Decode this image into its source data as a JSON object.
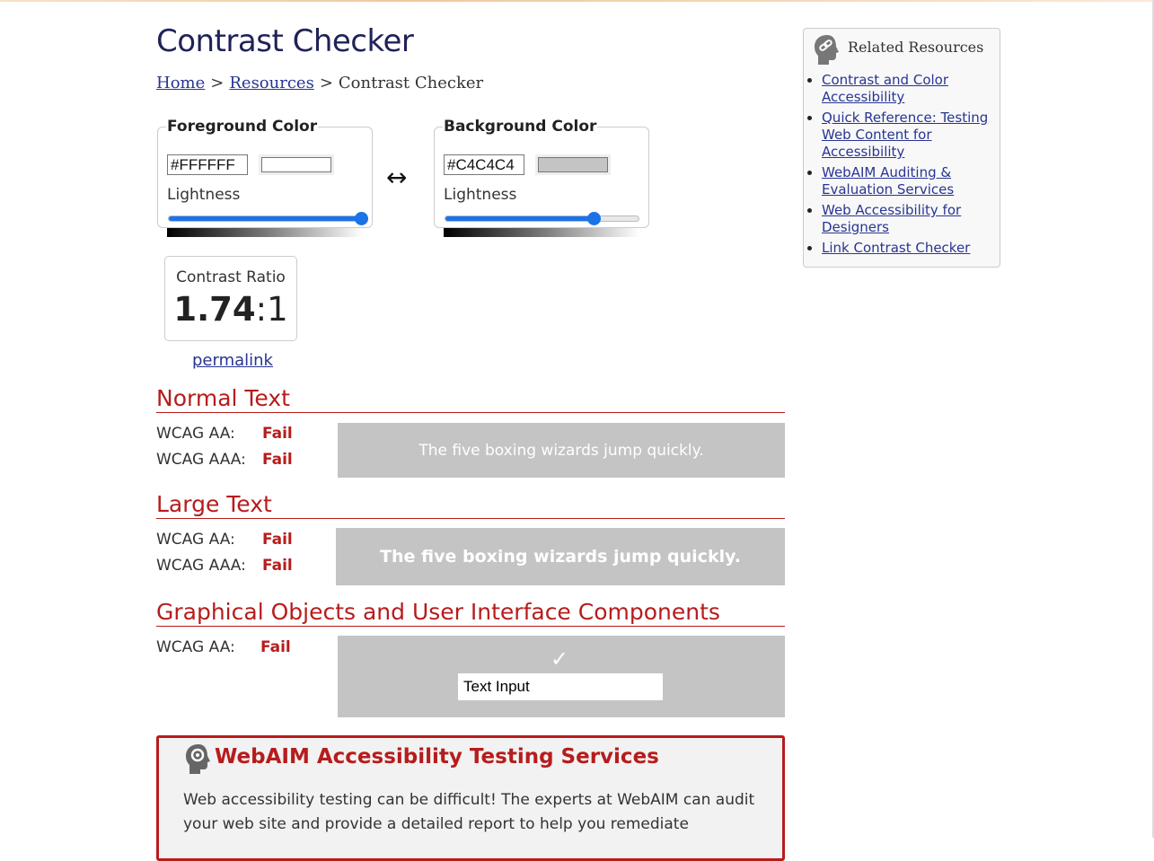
{
  "page": {
    "title": "Contrast Checker"
  },
  "breadcrumb": {
    "home": "Home",
    "separator": ">",
    "resources": "Resources",
    "current": "Contrast Checker"
  },
  "foreground": {
    "legend": "Foreground Color",
    "hex": "#FFFFFF",
    "swatch_color": "#FFFFFF",
    "lightness_label": "Lightness",
    "lightness_percent": 100
  },
  "background": {
    "legend": "Background Color",
    "hex": "#C4C4C4",
    "swatch_color": "#C4C4C4",
    "lightness_label": "Lightness",
    "lightness_percent": 77
  },
  "swap_icon": "↔",
  "contrast": {
    "label": "Contrast Ratio",
    "ratio": "1.74",
    "suffix": ":1",
    "permalink": "permalink"
  },
  "normal_text": {
    "heading": "Normal Text",
    "aa_label": "WCAG AA:",
    "aa_result": "Fail",
    "aaa_label": "WCAG AAA:",
    "aaa_result": "Fail",
    "sample": "The five boxing wizards jump quickly."
  },
  "large_text": {
    "heading": "Large Text",
    "aa_label": "WCAG AA:",
    "aa_result": "Fail",
    "aaa_label": "WCAG AAA:",
    "aaa_result": "Fail",
    "sample": "The five boxing wizards jump quickly."
  },
  "graphics": {
    "heading": "Graphical Objects and User Interface Components",
    "aa_label": "WCAG AA:",
    "aa_result": "Fail",
    "check_icon": "✓",
    "input_value": "Text Input"
  },
  "promo": {
    "title": "WebAIM Accessibility Testing Services",
    "text": "Web accessibility testing can be difficult! The experts at WebAIM can audit your web site and provide a detailed report to help you remediate"
  },
  "sidebar": {
    "title": "Related Resources",
    "links": [
      "Contrast and Color Accessibility",
      "Quick Reference: Testing Web Content for Accessibility",
      "WebAIM Auditing & Evaluation Services",
      "Web Accessibility for Designers",
      "Link Contrast Checker"
    ]
  },
  "colors": {
    "heading_navy": "#1f2257",
    "accent_red": "#b71c1c",
    "link_blue": "#283593",
    "slider_blue": "#1a73e8"
  }
}
